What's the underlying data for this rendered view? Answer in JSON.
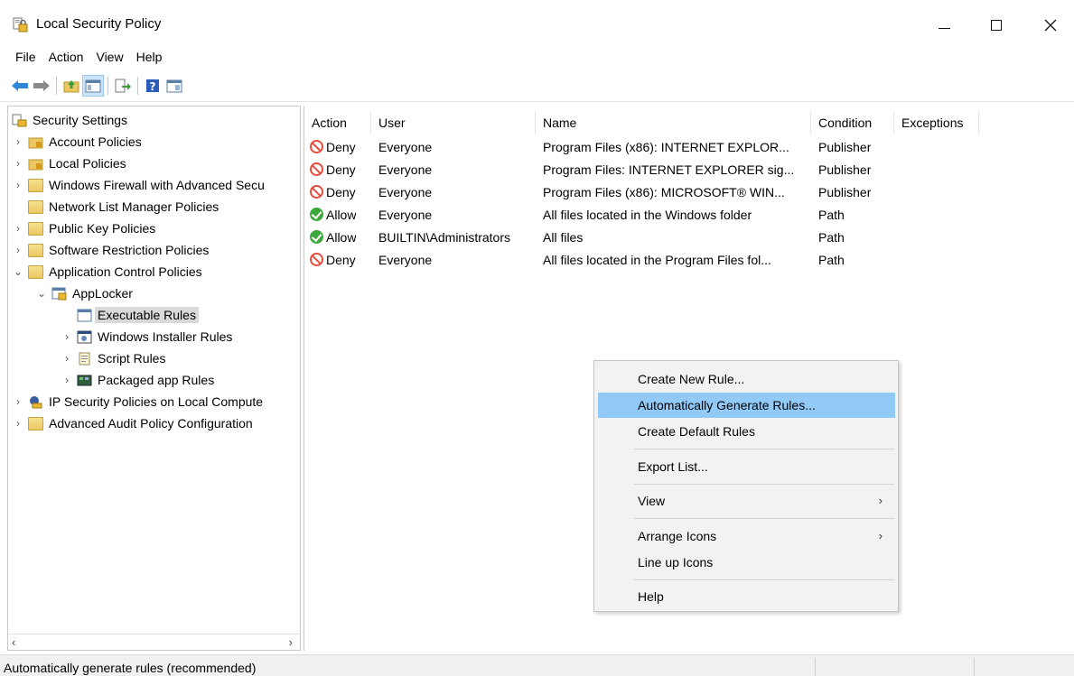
{
  "window": {
    "title": "Local Security Policy"
  },
  "menu": [
    "File",
    "Action",
    "View",
    "Help"
  ],
  "toolbar": {
    "buttons": [
      "back-arrow-icon",
      "forward-arrow-icon",
      "up-folder-icon",
      "show-hide-tree-icon",
      "export-list-icon",
      "help-icon",
      "properties-icon"
    ]
  },
  "tree": {
    "root": "Security Settings",
    "items": [
      {
        "label": "Account Policies"
      },
      {
        "label": "Local Policies"
      },
      {
        "label": "Windows Firewall with Advanced Secu"
      },
      {
        "label": "Network List Manager Policies"
      },
      {
        "label": "Public Key Policies"
      },
      {
        "label": "Software Restriction Policies"
      },
      {
        "label": "Application Control Policies"
      },
      {
        "label": "AppLocker"
      },
      {
        "label": "Executable Rules"
      },
      {
        "label": "Windows Installer Rules"
      },
      {
        "label": "Script Rules"
      },
      {
        "label": "Packaged app Rules"
      },
      {
        "label": "IP Security Policies on Local Compute"
      },
      {
        "label": "Advanced Audit Policy Configuration"
      }
    ]
  },
  "list": {
    "columns": [
      "Action",
      "User",
      "Name",
      "Condition",
      "Exceptions"
    ],
    "rows": [
      {
        "action": "Deny",
        "user": "Everyone",
        "name": "Program Files (x86): INTERNET EXPLOR...",
        "condition": "Publisher",
        "exceptions": ""
      },
      {
        "action": "Deny",
        "user": "Everyone",
        "name": "Program Files: INTERNET EXPLORER sig...",
        "condition": "Publisher",
        "exceptions": ""
      },
      {
        "action": "Deny",
        "user": "Everyone",
        "name": "Program Files (x86): MICROSOFT® WIN...",
        "condition": "Publisher",
        "exceptions": ""
      },
      {
        "action": "Allow",
        "user": "Everyone",
        "name": "All files located in the Windows folder",
        "condition": "Path",
        "exceptions": ""
      },
      {
        "action": "Allow",
        "user": "BUILTIN\\Administrators",
        "name": "All files",
        "condition": "Path",
        "exceptions": ""
      },
      {
        "action": "Deny",
        "user": "Everyone",
        "name": "All files located in the Program Files fol...",
        "condition": "Path",
        "exceptions": ""
      }
    ]
  },
  "context_menu": {
    "items": [
      "Create New Rule...",
      "Automatically Generate Rules...",
      "Create Default Rules",
      "Export List...",
      "View",
      "Arrange Icons",
      "Line up Icons",
      "Help"
    ],
    "highlighted": "Automatically Generate Rules..."
  },
  "status": {
    "text": "Automatically generate rules (recommended)"
  },
  "colors": {
    "highlight": "#91c9f7",
    "deny": "#e74c3c",
    "allow": "#3ca83c"
  }
}
